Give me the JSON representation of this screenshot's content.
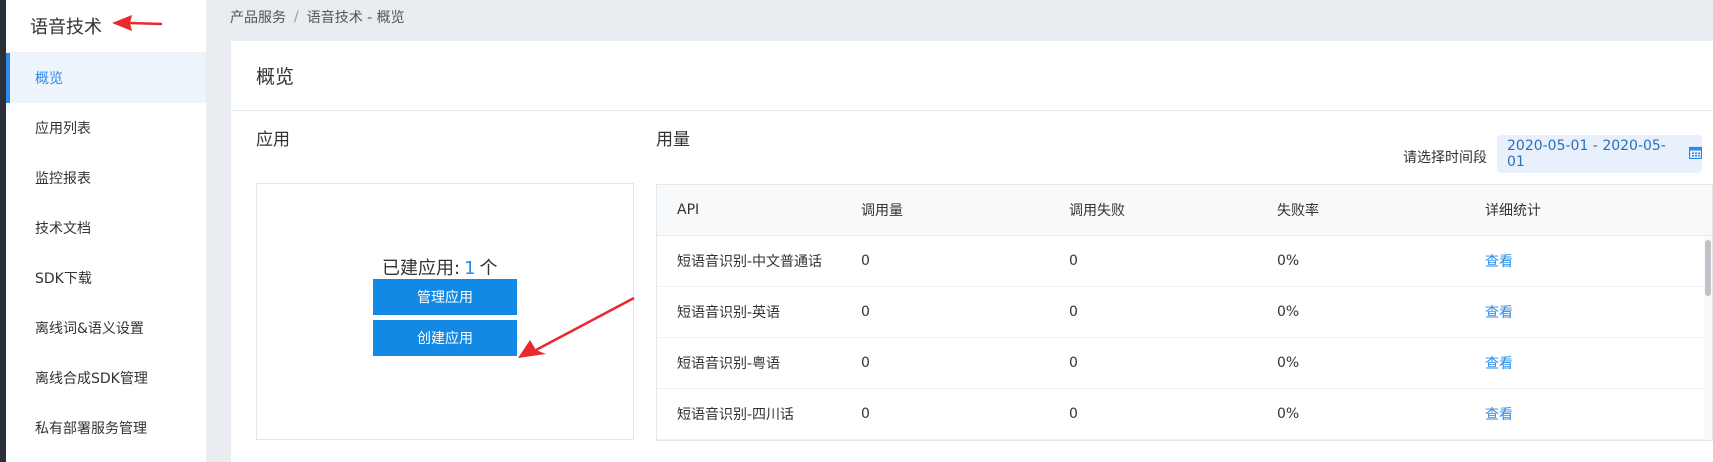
{
  "sidebar": {
    "title": "语音技术",
    "items": [
      {
        "label": "概览",
        "active": true
      },
      {
        "label": "应用列表"
      },
      {
        "label": "监控报表"
      },
      {
        "label": "技术文档"
      },
      {
        "label": "SDK下载"
      },
      {
        "label": "离线词&语义设置"
      },
      {
        "label": "离线合成SDK管理"
      },
      {
        "label": "私有部署服务管理"
      }
    ]
  },
  "breadcrumb": {
    "items": [
      "产品服务",
      "语音技术 - 概览"
    ],
    "separator": "/"
  },
  "page": {
    "title": "概览"
  },
  "apps": {
    "section_title": "应用",
    "count_prefix": "已建应用:",
    "count": "1",
    "count_suffix": "个",
    "manage_button": "管理应用",
    "create_button": "创建应用"
  },
  "usage": {
    "section_title": "用量",
    "date_label": "请选择时间段",
    "date_range": "2020-05-01 - 2020-05-01",
    "columns": [
      "API",
      "调用量",
      "调用失败",
      "失败率",
      "详细统计"
    ],
    "rows": [
      {
        "api": "短语音识别-中文普通话",
        "calls": "0",
        "failures": "0",
        "rate": "0%",
        "detail": "查看"
      },
      {
        "api": "短语音识别-英语",
        "calls": "0",
        "failures": "0",
        "rate": "0%",
        "detail": "查看"
      },
      {
        "api": "短语音识别-粤语",
        "calls": "0",
        "failures": "0",
        "rate": "0%",
        "detail": "查看"
      },
      {
        "api": "短语音识别-四川话",
        "calls": "0",
        "failures": "0",
        "rate": "0%",
        "detail": "查看"
      }
    ]
  },
  "colors": {
    "accent": "#2a8ce8",
    "button": "#1389e6",
    "annotation_arrow": "#e8292e"
  },
  "icons": {
    "date_picker": "calendar-icon"
  }
}
